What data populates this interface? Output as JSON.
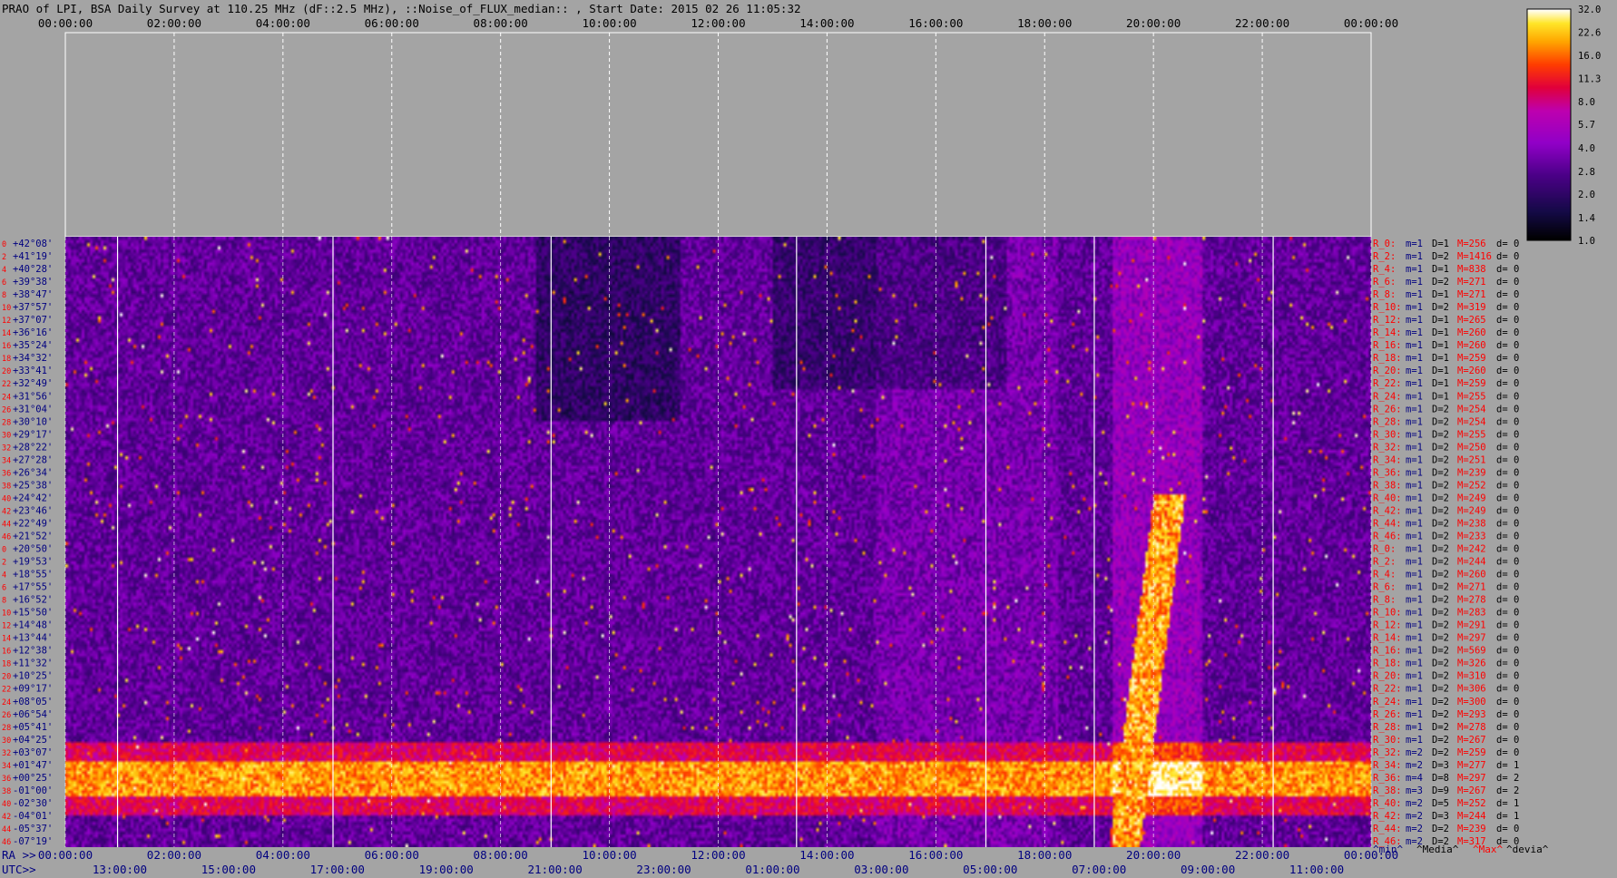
{
  "header": {
    "title": "PRAO of LPI, BSA Daily Survey at 110.25 MHz (dF::2.5 MHz), ::Noise_of_FLUX_median:: , Start Date: 2015 02 26 11:05:32"
  },
  "footer": {
    "ra_label": "RA >>",
    "utc_label": "UTC>>",
    "legend_min": "^min^",
    "legend_media": "^Media^",
    "legend_max": "^Max^",
    "legend_devia": "^devia^"
  },
  "colors": {
    "background": "#a4a4a4",
    "label_blue": "#000080",
    "label_red": "#ff0000",
    "max_label": "#ff0000"
  },
  "chart_data": {
    "type": "heatmap",
    "title": "PRAO of LPI, BSA Daily Survey at 110.25 MHz (dF::2.5 MHz), ::Noise_of_FLUX_median:: , Start Date: 2015 02 26 11:05:32",
    "x_top_ticks": [
      "00:00:00",
      "02:00:00",
      "04:00:00",
      "06:00:00",
      "08:00:00",
      "10:00:00",
      "12:00:00",
      "14:00:00",
      "16:00:00",
      "18:00:00",
      "20:00:00",
      "22:00:00",
      "00:00:00"
    ],
    "x_bottom_ra_ticks": [
      "00:00:00",
      "02:00:00",
      "04:00:00",
      "06:00:00",
      "08:00:00",
      "10:00:00",
      "12:00:00",
      "14:00:00",
      "16:00:00",
      "18:00:00",
      "20:00:00",
      "22:00:00",
      "00:00:00"
    ],
    "x_bottom_utc_ticks": [
      "13:00:00",
      "15:00:00",
      "17:00:00",
      "19:00:00",
      "21:00:00",
      "23:00:00",
      "01:00:00",
      "03:00:00",
      "05:00:00",
      "07:00:00",
      "09:00:00",
      "11:00:00"
    ],
    "colorbar_ticks": [
      "32.0",
      "22.6",
      "16.0",
      "11.3",
      "8.0",
      "5.7",
      "4.0",
      "2.8",
      "2.0",
      "1.4",
      "1.0"
    ],
    "colorbar_range": [
      1.0,
      32.0
    ],
    "colorbar_scale": "log",
    "y_declinations": [
      "+42°08'",
      "+41°19'",
      "+40°28'",
      "+39°38'",
      "+38°47'",
      "+37°57'",
      "+37°07'",
      "+36°16'",
      "+35°24'",
      "+34°32'",
      "+33°41'",
      "+32°49'",
      "+31°56'",
      "+31°04'",
      "+30°10'",
      "+29°17'",
      "+28°22'",
      "+27°28'",
      "+26°34'",
      "+25°38'",
      "+24°42'",
      "+23°46'",
      "+22°49'",
      "+21°52'",
      "+20°50'",
      "+19°53'",
      "+18°55'",
      "+17°55'",
      "+16°52'",
      "+15°50'",
      "+14°48'",
      "+13°44'",
      "+12°38'",
      "+11°32'",
      "+10°25'",
      "+09°17'",
      "+08°05'",
      "+06°54'",
      "+05°41'",
      "+04°25'",
      "+03°07'",
      "+01°47'",
      "+00°25'",
      "-01°00'",
      "-02°30'",
      "-04°01'",
      "-05°37'",
      "-07°19'"
    ],
    "y_beam_numbers": [
      "0",
      "2",
      "4",
      "6",
      "8",
      "10",
      "12",
      "14",
      "16",
      "18",
      "20",
      "22",
      "24",
      "26",
      "28",
      "30",
      "32",
      "34",
      "36",
      "38",
      "40",
      "42",
      "44",
      "46",
      "0",
      "2",
      "4",
      "6",
      "8",
      "10",
      "12",
      "14",
      "16",
      "18",
      "20",
      "22",
      "24",
      "26",
      "28",
      "30",
      "32",
      "34",
      "36",
      "38",
      "40",
      "42",
      "44",
      "46"
    ],
    "row_stats": [
      {
        "label": "R_0:",
        "m": "m=1",
        "D": "D=1",
        "M": "M=256",
        "d": "d= 0"
      },
      {
        "label": "R_2:",
        "m": "m=1",
        "D": "D=2",
        "M": "M=1416",
        "d": "d= 0"
      },
      {
        "label": "R_4:",
        "m": "m=1",
        "D": "D=1",
        "M": "M=838",
        "d": "d= 0"
      },
      {
        "label": "R_6:",
        "m": "m=1",
        "D": "D=2",
        "M": "M=271",
        "d": "d= 0"
      },
      {
        "label": "R_8:",
        "m": "m=1",
        "D": "D=1",
        "M": "M=271",
        "d": "d= 0"
      },
      {
        "label": "R_10:",
        "m": "m=1",
        "D": "D=2",
        "M": "M=319",
        "d": "d= 0"
      },
      {
        "label": "R_12:",
        "m": "m=1",
        "D": "D=1",
        "M": "M=265",
        "d": "d= 0"
      },
      {
        "label": "R_14:",
        "m": "m=1",
        "D": "D=1",
        "M": "M=260",
        "d": "d= 0"
      },
      {
        "label": "R_16:",
        "m": "m=1",
        "D": "D=1",
        "M": "M=260",
        "d": "d= 0"
      },
      {
        "label": "R_18:",
        "m": "m=1",
        "D": "D=1",
        "M": "M=259",
        "d": "d= 0"
      },
      {
        "label": "R_20:",
        "m": "m=1",
        "D": "D=1",
        "M": "M=260",
        "d": "d= 0"
      },
      {
        "label": "R_22:",
        "m": "m=1",
        "D": "D=1",
        "M": "M=259",
        "d": "d= 0"
      },
      {
        "label": "R_24:",
        "m": "m=1",
        "D": "D=1",
        "M": "M=255",
        "d": "d= 0"
      },
      {
        "label": "R_26:",
        "m": "m=1",
        "D": "D=2",
        "M": "M=254",
        "d": "d= 0"
      },
      {
        "label": "R_28:",
        "m": "m=1",
        "D": "D=2",
        "M": "M=254",
        "d": "d= 0"
      },
      {
        "label": "R_30:",
        "m": "m=1",
        "D": "D=2",
        "M": "M=255",
        "d": "d= 0"
      },
      {
        "label": "R_32:",
        "m": "m=1",
        "D": "D=2",
        "M": "M=250",
        "d": "d= 0"
      },
      {
        "label": "R_34:",
        "m": "m=1",
        "D": "D=2",
        "M": "M=251",
        "d": "d= 0"
      },
      {
        "label": "R_36:",
        "m": "m=1",
        "D": "D=2",
        "M": "M=239",
        "d": "d= 0"
      },
      {
        "label": "R_38:",
        "m": "m=1",
        "D": "D=2",
        "M": "M=252",
        "d": "d= 0"
      },
      {
        "label": "R_40:",
        "m": "m=1",
        "D": "D=2",
        "M": "M=249",
        "d": "d= 0"
      },
      {
        "label": "R_42:",
        "m": "m=1",
        "D": "D=2",
        "M": "M=249",
        "d": "d= 0"
      },
      {
        "label": "R_44:",
        "m": "m=1",
        "D": "D=2",
        "M": "M=238",
        "d": "d= 0"
      },
      {
        "label": "R_46:",
        "m": "m=1",
        "D": "D=2",
        "M": "M=233",
        "d": "d= 0"
      },
      {
        "label": "R_0:",
        "m": "m=1",
        "D": "D=2",
        "M": "M=242",
        "d": "d= 0"
      },
      {
        "label": "R_2:",
        "m": "m=1",
        "D": "D=2",
        "M": "M=244",
        "d": "d= 0"
      },
      {
        "label": "R_4:",
        "m": "m=1",
        "D": "D=2",
        "M": "M=260",
        "d": "d= 0"
      },
      {
        "label": "R_6:",
        "m": "m=1",
        "D": "D=2",
        "M": "M=271",
        "d": "d= 0"
      },
      {
        "label": "R_8:",
        "m": "m=1",
        "D": "D=2",
        "M": "M=278",
        "d": "d= 0"
      },
      {
        "label": "R_10:",
        "m": "m=1",
        "D": "D=2",
        "M": "M=283",
        "d": "d= 0"
      },
      {
        "label": "R_12:",
        "m": "m=1",
        "D": "D=2",
        "M": "M=291",
        "d": "d= 0"
      },
      {
        "label": "R_14:",
        "m": "m=1",
        "D": "D=2",
        "M": "M=297",
        "d": "d= 0"
      },
      {
        "label": "R_16:",
        "m": "m=1",
        "D": "D=2",
        "M": "M=569",
        "d": "d= 0"
      },
      {
        "label": "R_18:",
        "m": "m=1",
        "D": "D=2",
        "M": "M=326",
        "d": "d= 0"
      },
      {
        "label": "R_20:",
        "m": "m=1",
        "D": "D=2",
        "M": "M=310",
        "d": "d= 0"
      },
      {
        "label": "R_22:",
        "m": "m=1",
        "D": "D=2",
        "M": "M=306",
        "d": "d= 0"
      },
      {
        "label": "R_24:",
        "m": "m=1",
        "D": "D=2",
        "M": "M=300",
        "d": "d= 0"
      },
      {
        "label": "R_26:",
        "m": "m=1",
        "D": "D=2",
        "M": "M=293",
        "d": "d= 0"
      },
      {
        "label": "R_28:",
        "m": "m=1",
        "D": "D=2",
        "M": "M=278",
        "d": "d= 0"
      },
      {
        "label": "R_30:",
        "m": "m=1",
        "D": "D=2",
        "M": "M=267",
        "d": "d= 0"
      },
      {
        "label": "R_32:",
        "m": "m=2",
        "D": "D=2",
        "M": "M=259",
        "d": "d= 0"
      },
      {
        "label": "R_34:",
        "m": "m=2",
        "D": "D=3",
        "M": "M=277",
        "d": "d= 1"
      },
      {
        "label": "R_36:",
        "m": "m=4",
        "D": "D=8",
        "M": "M=297",
        "d": "d= 2"
      },
      {
        "label": "R_38:",
        "m": "m=3",
        "D": "D=9",
        "M": "M=267",
        "d": "d= 2"
      },
      {
        "label": "R_40:",
        "m": "m=2",
        "D": "D=5",
        "M": "M=252",
        "d": "d= 1"
      },
      {
        "label": "R_42:",
        "m": "m=2",
        "D": "D=3",
        "M": "M=244",
        "d": "d= 1"
      },
      {
        "label": "R_44:",
        "m": "m=2",
        "D": "D=2",
        "M": "M=239",
        "d": "d= 0"
      },
      {
        "label": "R_46:",
        "m": "m=2",
        "D": "D=2",
        "M": "M=317",
        "d": "d= 0"
      }
    ]
  }
}
